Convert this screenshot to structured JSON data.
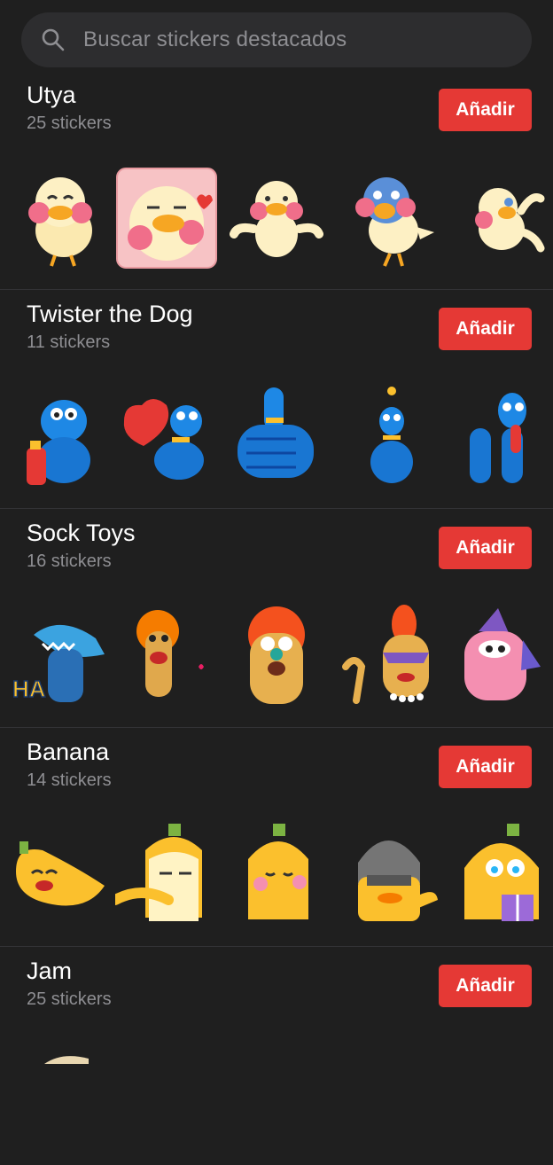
{
  "search": {
    "placeholder": "Buscar stickers destacados"
  },
  "packs": [
    {
      "title": "Utya",
      "count": "25 stickers",
      "button": "Añadir",
      "stickers": [
        "duck-laughing-sticker",
        "duck-heart-sticker",
        "duck-shrug-sticker",
        "blue-duck-sticker",
        "duck-dancing-sticker"
      ]
    },
    {
      "title": "Twister the Dog",
      "count": "11 stickers",
      "button": "Añadir",
      "stickers": [
        "balloon-dog-extinguisher-sticker",
        "balloon-dog-heart-sticker",
        "balloon-thumbs-up-sticker",
        "balloon-dog-bee-sticker",
        "balloon-dog-tongue-sticker"
      ]
    },
    {
      "title": "Sock Toys",
      "count": "16 stickers",
      "button": "Añadir",
      "stickers": [
        "sock-shark-ha-sticker",
        "sock-orange-hair-sticker",
        "sock-orange-surprised-sticker",
        "sock-lady-mask-sticker",
        "sock-party-hat-sticker"
      ]
    },
    {
      "title": "Banana",
      "count": "14 stickers",
      "button": "Añadir",
      "stickers": [
        "banana-laughing-sticker",
        "banana-sleepy-sticker",
        "banana-shy-sticker",
        "banana-helmet-sticker",
        "banana-gift-sticker"
      ]
    },
    {
      "title": "Jam",
      "count": "25 stickers",
      "button": "Añadir",
      "stickers": []
    }
  ],
  "colors": {
    "accent": "#e53935",
    "background": "#1f1f1f",
    "search_bg": "#2d2d2f",
    "muted_text": "#8e8e92"
  }
}
